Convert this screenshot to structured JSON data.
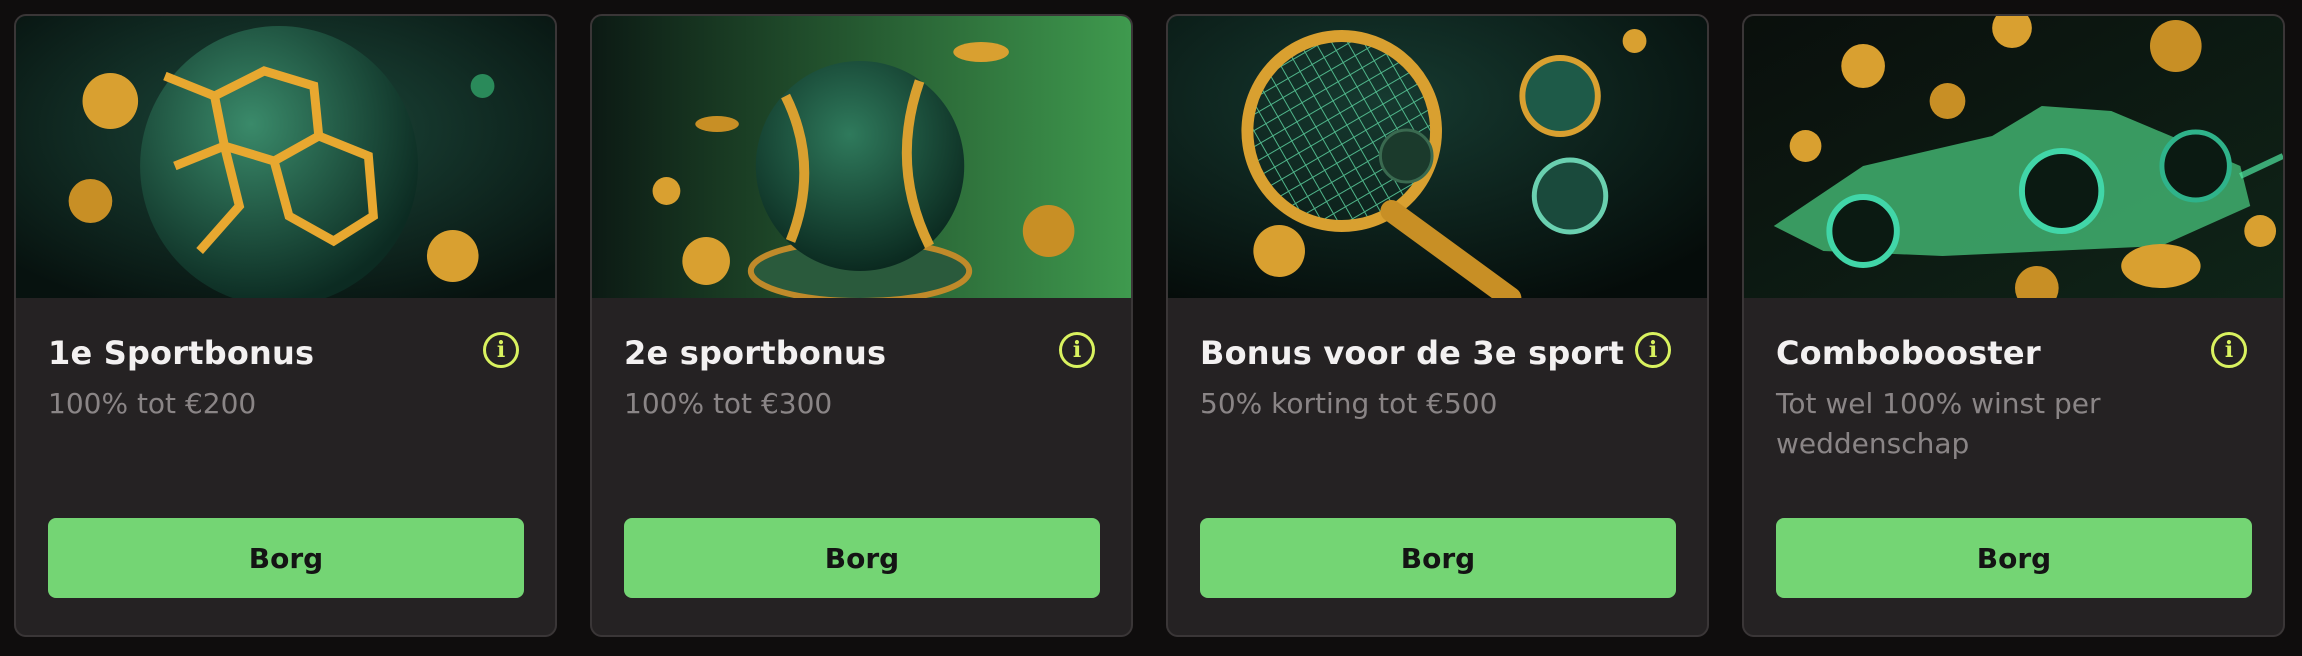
{
  "cards": [
    {
      "title": "1e Sportbonus",
      "description": "100% tot €200",
      "button_label": "Borg",
      "info_icon": "i",
      "image_subject": "soccer-ball"
    },
    {
      "title": "2e sportbonus",
      "description": "100% tot €300",
      "button_label": "Borg",
      "info_icon": "i",
      "image_subject": "baseball"
    },
    {
      "title": "Bonus voor de 3e sport",
      "description": "50% korting tot €500",
      "button_label": "Borg",
      "info_icon": "i",
      "image_subject": "tennis-racket"
    },
    {
      "title": "Combobooster",
      "description": "Tot wel 100% winst per weddenschap",
      "button_label": "Borg",
      "info_icon": "i",
      "image_subject": "race-car"
    }
  ],
  "colors": {
    "accent_green": "#74d574",
    "info_yellow": "#d9f25f",
    "card_bg": "#252223",
    "page_bg": "#0f0d0d"
  }
}
